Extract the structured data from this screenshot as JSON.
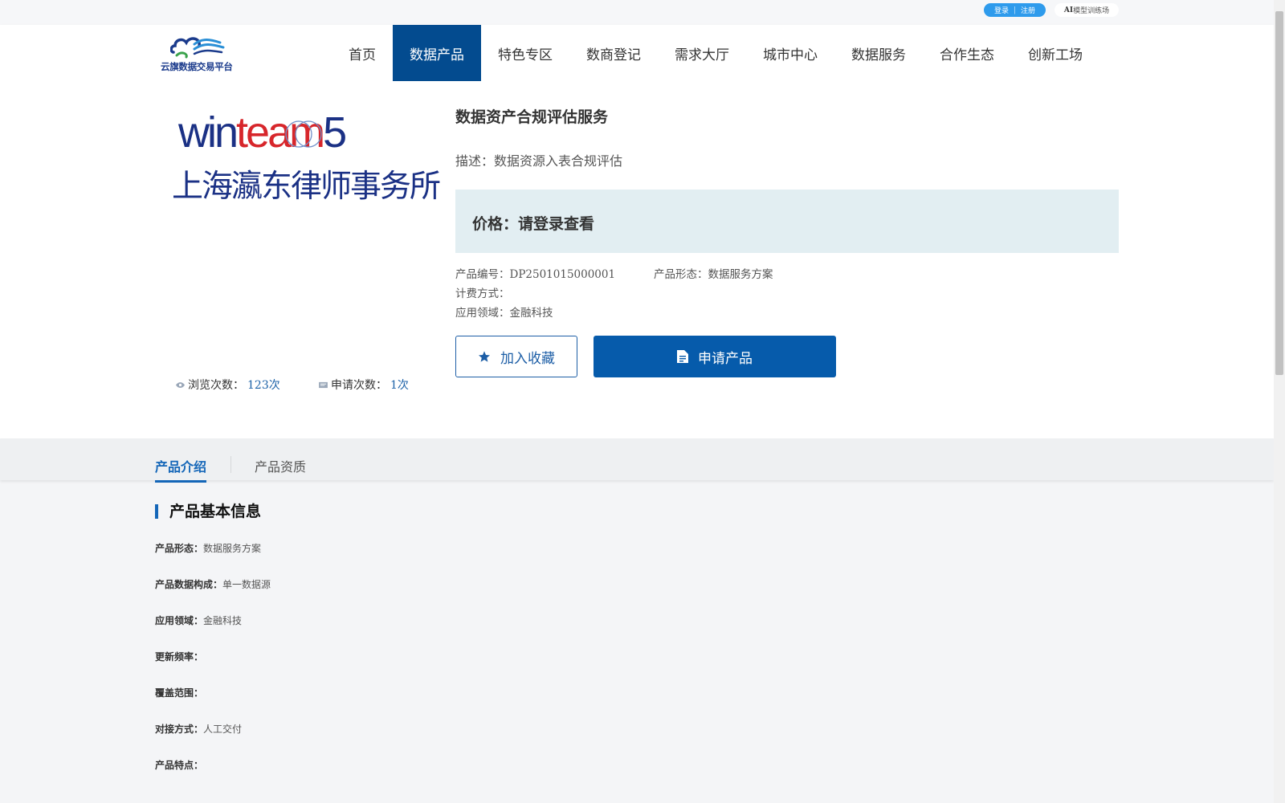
{
  "topbar": {
    "login": "登录",
    "divider": "|",
    "register": "注册",
    "ai_prefix": "AI",
    "ai_suffix": "模型训练场"
  },
  "header": {
    "logo_text": "云旗数据交易平台",
    "nav": [
      "首页",
      "数据产品",
      "特色专区",
      "数商登记",
      "需求大厅",
      "城市中心",
      "数据服务",
      "合作生态",
      "创新工场"
    ],
    "active_nav": "数据产品"
  },
  "product": {
    "logo": {
      "brand_win": "win",
      "brand_team": "team",
      "brand_num": "5",
      "org_name": "上海瀛东律师事务所"
    },
    "title": "数据资产合规评估服务",
    "description": "描述：数据资源入表合规评估",
    "price": "价格：请登录查看",
    "code_label": "产品编号：",
    "code": "DP2501015000001",
    "form_label": "产品形态：",
    "form": "数据服务方案",
    "billing_label": "计费方式：",
    "billing": "",
    "field_label": "应用领域：",
    "field": "金融科技",
    "views_label": "浏览次数：",
    "views": "123次",
    "applies_label": "申请次数：",
    "applies": "1次",
    "favorite_button": "加入收藏",
    "apply_button": "申请产品"
  },
  "tabs": [
    "产品介绍",
    "产品资质"
  ],
  "basic_info": {
    "title": "产品基本信息",
    "rows": [
      {
        "label": "产品形态：",
        "value": "数据服务方案"
      },
      {
        "label": "产品数据构成：",
        "value": "单一数据源"
      },
      {
        "label": "应用领域：",
        "value": "金融科技"
      },
      {
        "label": "更新频率：",
        "value": ""
      },
      {
        "label": "覆盖范围：",
        "value": ""
      },
      {
        "label": "对接方式：",
        "value": "人工交付"
      },
      {
        "label": "产品特点：",
        "value": ""
      }
    ]
  },
  "colors": {
    "primary": "#034b8f",
    "button": "#065bab",
    "accent_blue": "#1466b8",
    "price_bg": "#e2eef2",
    "brand_red": "#d7262b",
    "brand_navy": "#1b3185"
  }
}
